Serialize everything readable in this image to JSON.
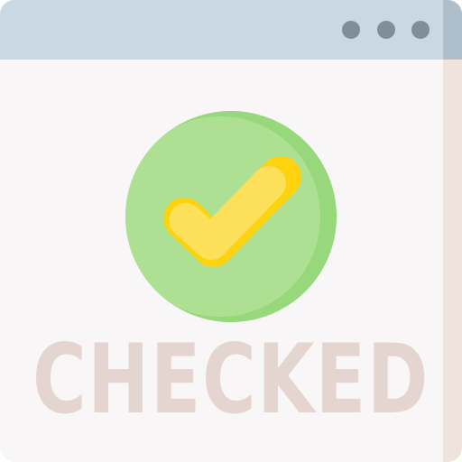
{
  "window": {
    "title_bar_color": "#c9d8e2",
    "title_bar_shade": "#aebfcb",
    "body_color": "#f8f6f6",
    "body_shade": "#efe3de",
    "controls": [
      {
        "icon": "dot-icon",
        "color": "#7f8e98"
      },
      {
        "icon": "dot-icon",
        "color": "#7f8e98"
      },
      {
        "icon": "dot-icon",
        "color": "#7f8e98"
      }
    ]
  },
  "badge": {
    "icon": "checkmark-icon",
    "circle_color": "#aee094",
    "circle_shade": "#98d87c",
    "check_color": "#fde05a",
    "check_shade": "#fdd20e"
  },
  "caption": {
    "text": "CHECKED",
    "color": "#e5d5d0"
  }
}
